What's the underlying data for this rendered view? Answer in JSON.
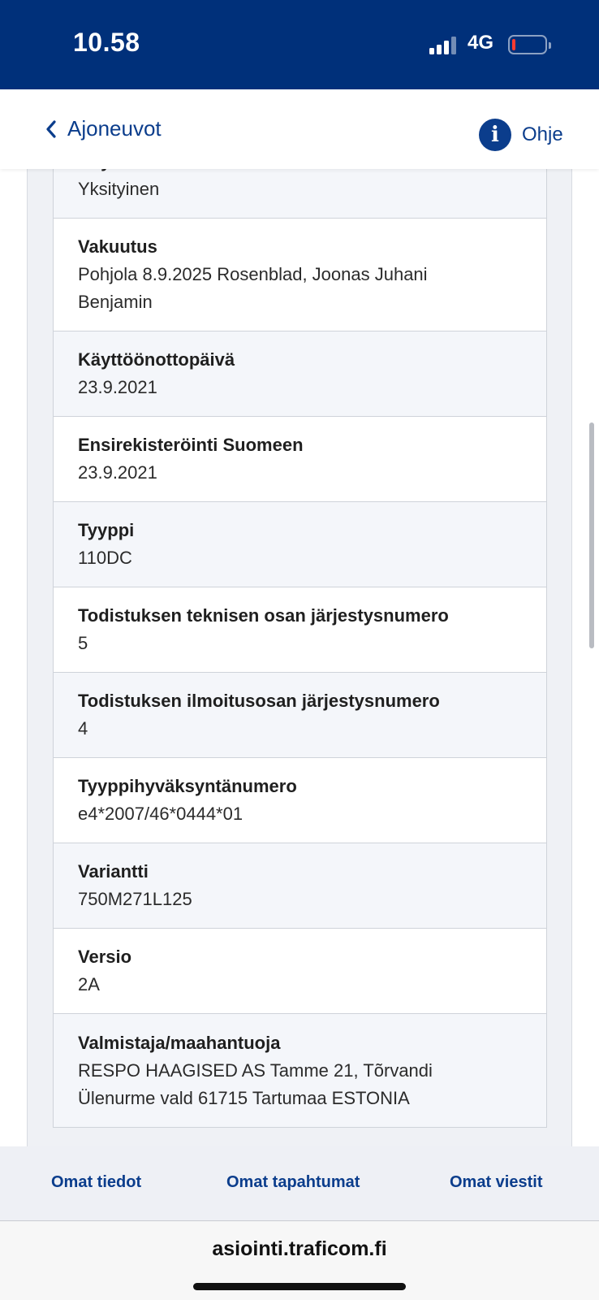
{
  "status_bar": {
    "time": "10.58",
    "network": "4G",
    "battery_level": 0.1,
    "battery_color": "#ff3b30",
    "background_color": "#00307a"
  },
  "header": {
    "back_label": "Ajoneuvot",
    "back_icon": "chevron-left-icon",
    "help_icon_glyph": "i",
    "help_label": "Ohje",
    "accent_color": "#0b3d8c"
  },
  "details": [
    {
      "label": "Käyttö",
      "value": "Yksityinen"
    },
    {
      "label": "Vakuutus",
      "value_lines": [
        "Pohjola 8.9.2025 Rosenblad, Joonas Juhani",
        "Benjamin"
      ]
    },
    {
      "label": "Käyttöönottopäivä",
      "value": "23.9.2021"
    },
    {
      "label": "Ensirekisteröinti Suomeen",
      "value": "23.9.2021"
    },
    {
      "label": "Tyyppi",
      "value": "110DC"
    },
    {
      "label": "Todistuksen teknisen osan järjestysnumero",
      "value": "5"
    },
    {
      "label": "Todistuksen ilmoitusosan järjestysnumero",
      "value": "4"
    },
    {
      "label": "Tyyppihyväksyntänumero",
      "value": "e4*2007/46*0444*01"
    },
    {
      "label": "Variantti",
      "value": "750M271L125"
    },
    {
      "label": "Versio",
      "value": "2A"
    },
    {
      "label": "Valmistaja/maahantuoja",
      "value_lines": [
        "RESPO HAAGISED AS Tamme 21, Tõrvandi",
        "Ülenurme vald 61715 Tartumaa ESTONIA"
      ]
    }
  ],
  "tabs": [
    {
      "label": "Omat tiedot"
    },
    {
      "label": "Omat tapahtumat"
    },
    {
      "label": "Omat viestit"
    }
  ],
  "browser": {
    "url": "asiointi.traficom.fi"
  }
}
